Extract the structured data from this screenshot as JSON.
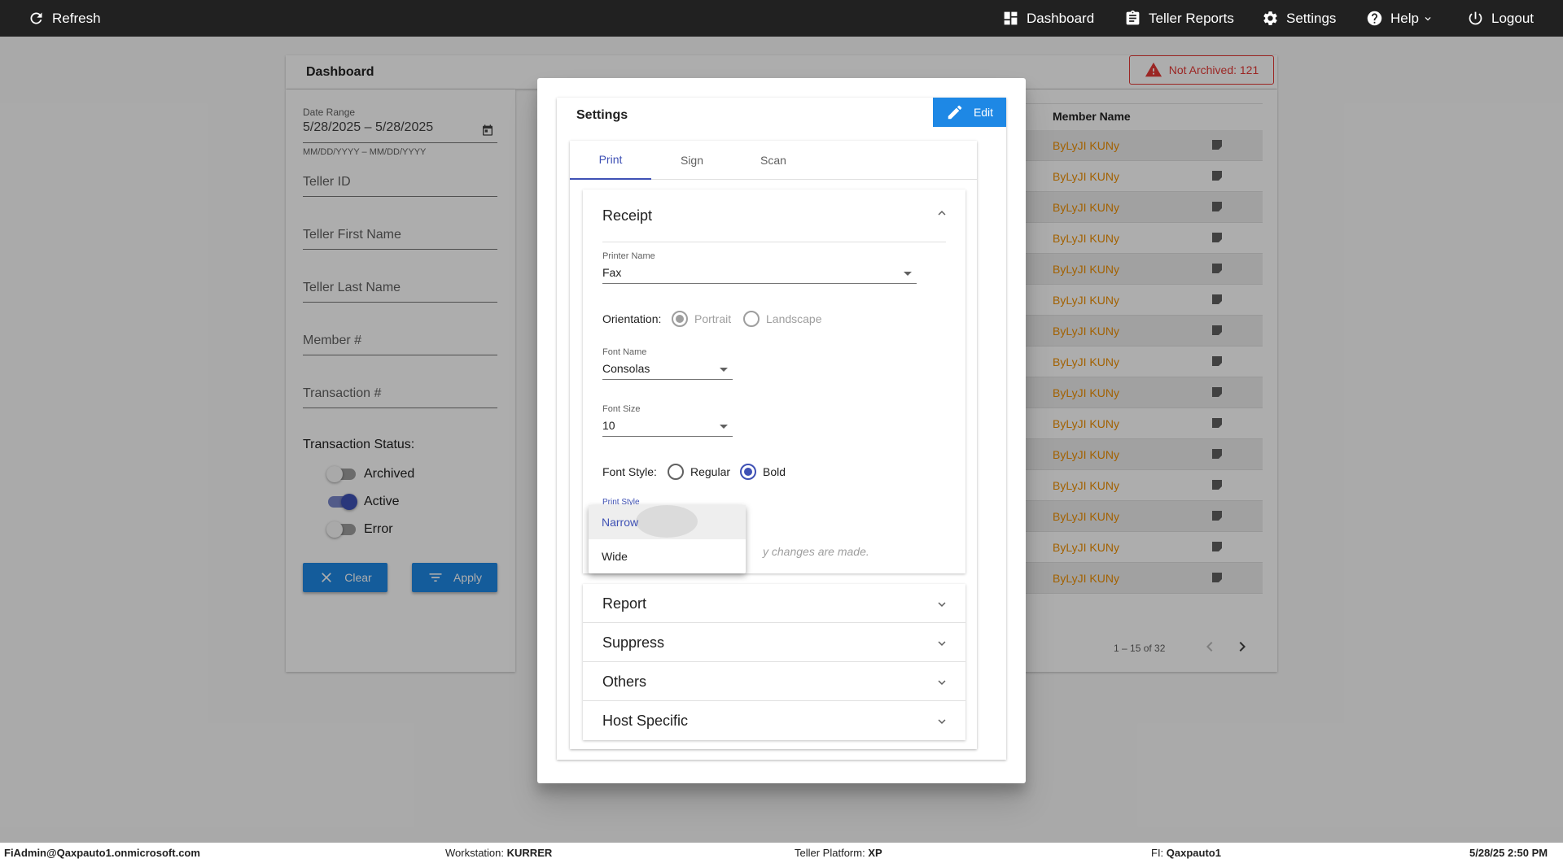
{
  "topnav": {
    "refresh": "Refresh",
    "dashboard": "Dashboard",
    "teller_reports": "Teller Reports",
    "settings": "Settings",
    "help": "Help",
    "logout": "Logout"
  },
  "dashboard": {
    "title": "Dashboard",
    "not_archived": "Not Archived: 121"
  },
  "filters": {
    "date_range_label": "Date Range",
    "date_range_value": "5/28/2025 – 5/28/2025",
    "date_range_hint": "MM/DD/YYYY – MM/DD/YYYY",
    "teller_id": "Teller ID",
    "teller_first_name": "Teller First Name",
    "teller_last_name": "Teller Last Name",
    "member_num": "Member #",
    "transaction_num": "Transaction #",
    "status_title": "Transaction Status:",
    "statuses": [
      {
        "label": "Archived",
        "on": false
      },
      {
        "label": "Active",
        "on": true
      },
      {
        "label": "Error",
        "on": false
      }
    ],
    "clear": "Clear",
    "apply": "Apply"
  },
  "table": {
    "member_header": "Member Name",
    "rows": [
      "ByLyJI KUNy",
      "ByLyJI KUNy",
      "ByLyJI KUNy",
      "ByLyJI KUNy",
      "ByLyJI KUNy",
      "ByLyJI KUNy",
      "ByLyJI KUNy",
      "ByLyJI KUNy",
      "ByLyJI KUNy",
      "ByLyJI KUNy",
      "ByLyJI KUNy",
      "ByLyJI KUNy",
      "ByLyJI KUNy",
      "ByLyJI KUNy",
      "ByLyJI KUNy"
    ],
    "pager": "1 – 15 of 32"
  },
  "settings_dialog": {
    "title": "Settings",
    "edit": "Edit",
    "tabs": [
      "Print",
      "Sign",
      "Scan"
    ],
    "active_tab": "Print",
    "receipt": {
      "title": "Receipt",
      "printer_name_label": "Printer Name",
      "printer_name": "Fax",
      "orientation_label": "Orientation:",
      "orientation_options": [
        "Portrait",
        "Landscape"
      ],
      "orientation_selected": "Portrait",
      "font_name_label": "Font Name",
      "font_name": "Consolas",
      "font_size_label": "Font Size",
      "font_size": "10",
      "font_style_label": "Font Style:",
      "font_style_options": [
        "Regular",
        "Bold"
      ],
      "font_style_selected": "Bold",
      "print_style_label": "Print Style",
      "print_style_options": [
        "Narrow",
        "Wide"
      ],
      "print_style_selected": "Narrow",
      "note_tail": "y changes are made."
    },
    "sections": [
      "Report",
      "Suppress",
      "Others",
      "Host Specific"
    ]
  },
  "footer": {
    "user": "FiAdmin@Qaxpauto1.onmicrosoft.com",
    "workstation_label": "Workstation:",
    "workstation": "KURRER",
    "platform_label": "Teller Platform:",
    "platform": "XP",
    "fi_label": "FI:",
    "fi": "Qaxpauto1",
    "datetime": "5/28/25 2:50 PM"
  }
}
